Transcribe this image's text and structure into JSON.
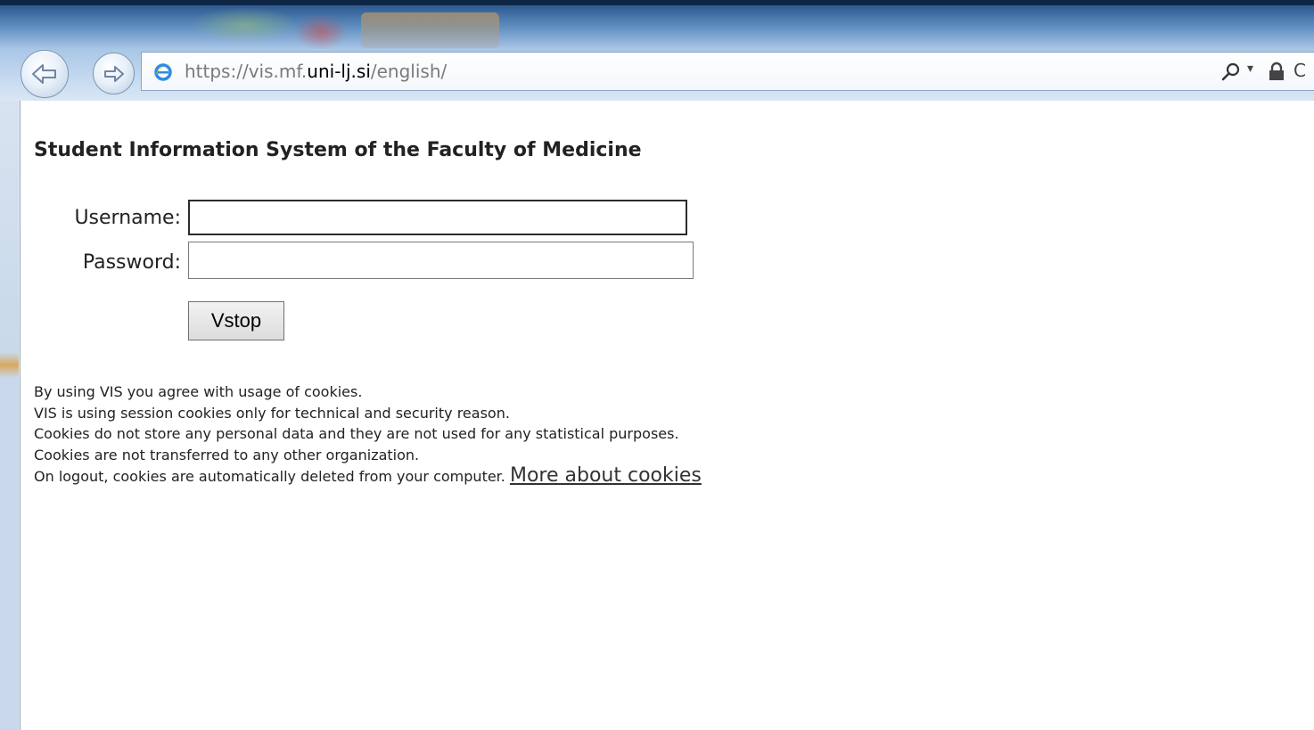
{
  "browser": {
    "url_prefix": "https://vis.mf.",
    "url_domain": "uni-lj.si",
    "url_path": "/english/",
    "search_dropdown": "▾",
    "refresh_glyph": "C"
  },
  "page": {
    "title": "Student Information System of the Faculty of Medicine",
    "username_label": "Username:",
    "password_label": "Password:",
    "username_value": "",
    "password_value": "",
    "submit_label": "Vstop"
  },
  "cookies": {
    "lines": [
      "By using VIS you agree with usage of cookies.",
      "VIS is using session cookies only for technical and security reason.",
      "Cookies do not store any personal data and they are not used for any statistical purposes.",
      "Cookies are not transferred to any other organization.",
      "On logout, cookies are automatically deleted from your computer."
    ],
    "more_link": "More about cookies"
  },
  "icons": {
    "back": "back-arrow-icon",
    "forward": "forward-arrow-icon",
    "site": "internet-explorer-icon",
    "search": "search-icon",
    "lock": "lock-icon",
    "refresh": "refresh-icon"
  },
  "colors": {
    "chrome_dark": "#1d3f6e",
    "chrome_light": "#cfe0f2",
    "link": "#333333",
    "text": "#222222"
  }
}
